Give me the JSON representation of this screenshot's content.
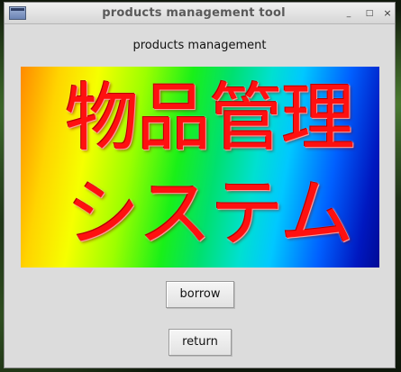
{
  "window": {
    "title": "products management tool",
    "controls": {
      "minimize": "_",
      "maximize": "□",
      "close": "×"
    }
  },
  "main": {
    "heading": "products management",
    "banner": {
      "line1": "物品管理",
      "line2": "システム",
      "text_color": "#ff1010"
    },
    "buttons": {
      "borrow": "borrow",
      "return": "return"
    }
  },
  "icons": {
    "app": "window-app-icon"
  }
}
